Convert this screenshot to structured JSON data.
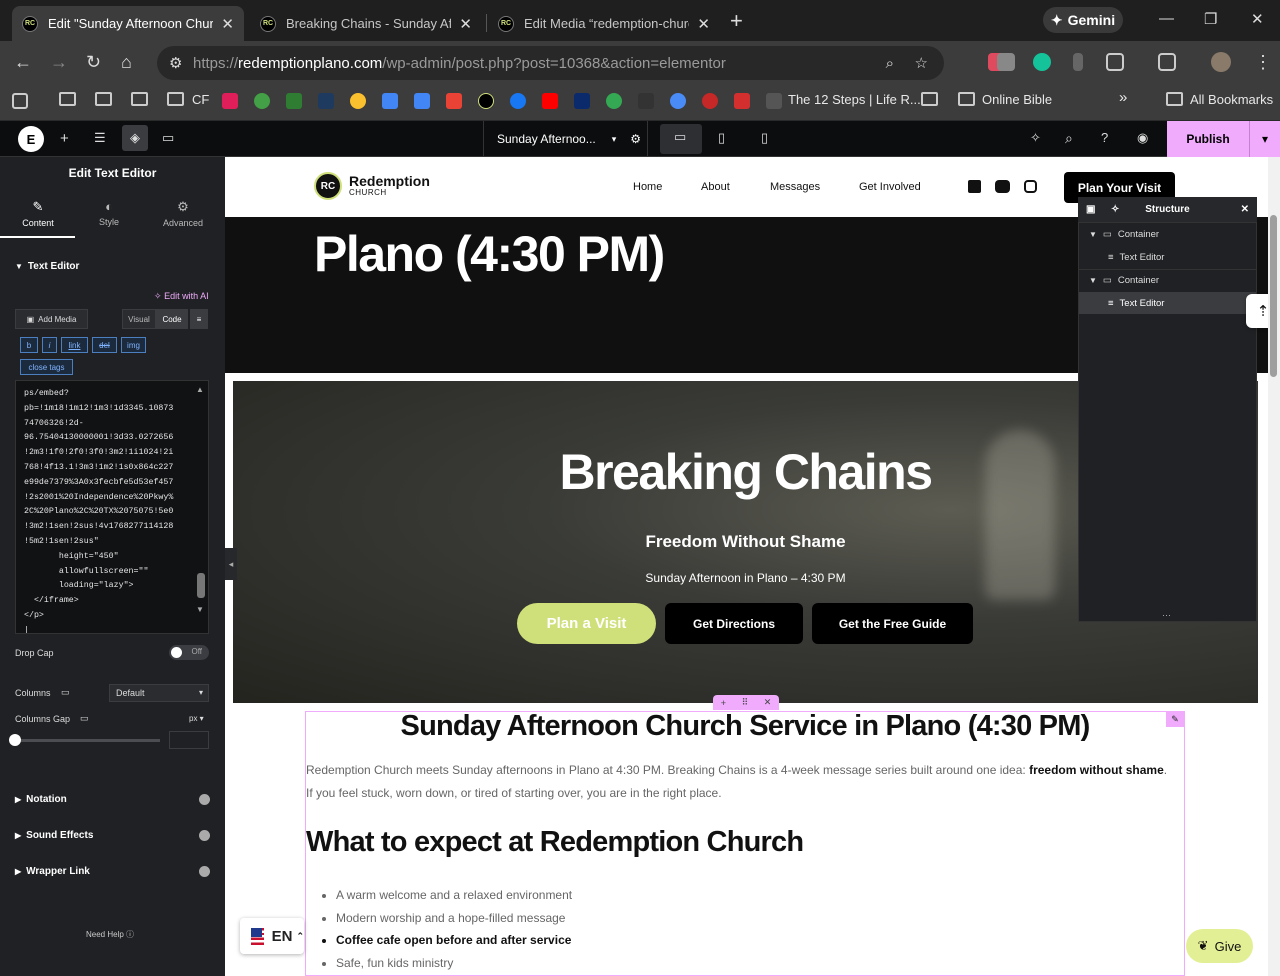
{
  "browser": {
    "tabs": [
      {
        "title": "Edit \"Sunday Afternoon Church",
        "active": true
      },
      {
        "title": "Breaking Chains - Sunday After",
        "active": false
      },
      {
        "title": "Edit Media “redemption-church",
        "active": false
      }
    ],
    "gemini_label": "Gemini",
    "url_prefix": "https://",
    "url_domain": "redemptionplano.com",
    "url_path": "/wp-admin/post.php?post=10368&action=elementor",
    "bookmarks": {
      "cf": "CF",
      "steps": "The 12 Steps | Life R...",
      "online_bible": "Online Bible",
      "all": "All Bookmarks"
    }
  },
  "editor": {
    "doc_title": "Sunday Afternoo...",
    "publish_label": "Publish",
    "panel_title": "Edit Text Editor",
    "panel_tabs": [
      "Content",
      "Style",
      "Advanced"
    ],
    "section_text_editor": "Text Editor",
    "edit_ai": "Edit with AI",
    "add_media": "Add Media",
    "visual_tab": "Visual",
    "code_tab": "Code",
    "quicktags": [
      "b",
      "i",
      "link",
      "del",
      "img",
      "close tags"
    ],
    "code": "ps/embed?\npb=!1m18!1m12!1m3!1d3345.10873\n74706326!2d-\n96.75404130000001!3d33.0272656\n!2m3!1f0!2f0!3f0!3m2!1i1024!2i\n768!4f13.1!3m3!1m2!1s0x864c227\ne99de7379%3A0x3fecbfe5d53ef457\n!2s2001%20Independence%20Pkwy%\n2C%20Plano%2C%20TX%2075075!5e0\n!3m2!1sen!2sus!4v1768277114128\n!5m2!1sen!2sus\"\n       height=\"450\"\n       allowfullscreen=\"\"\n       loading=\"lazy\">\n  </iframe>\n</p>\n|",
    "drop_cap_label": "Drop Cap",
    "drop_cap_state": "Off",
    "columns_label": "Columns",
    "columns_value": "Default",
    "columns_gap_label": "Columns Gap",
    "columns_gap_unit": "px",
    "sections": [
      "Notation",
      "Sound Effects",
      "Wrapper Link"
    ],
    "need_help": "Need Help",
    "structure_title": "Structure",
    "structure_rows": [
      "Container",
      "Text Editor",
      "Container",
      "Text Editor"
    ],
    "lang": "EN"
  },
  "site": {
    "logo_initials": "RC",
    "logo_name": "Redemption",
    "logo_sub": "CHURCH",
    "nav": [
      "Home",
      "About",
      "Messages",
      "Get Involved"
    ],
    "cta": "Plan Your Visit",
    "hero_top_title": "Plano (4:30 PM)",
    "hero_title": "Breaking Chains",
    "hero_subtitle": "Freedom Without Shame",
    "hero_time": "Sunday Afternoon in Plano – 4:30 PM",
    "hero_buttons": [
      "Plan a Visit",
      "Get Directions",
      "Get the Free Guide"
    ],
    "heading": "Sunday Afternoon Church Service in Plano (4:30 PM)",
    "intro_1": "Redemption Church meets Sunday afternoons in Plano at 4:30 PM. Breaking Chains is a 4-week message series built around one idea: ",
    "intro_bold": "freedom without shame",
    "intro_2": ". If you feel stuck, worn down, or tired of starting over, you are in the right place.",
    "expect_heading": "What to expect at Redemption Church",
    "expect_list": [
      "A warm welcome and a relaxed environment",
      "Modern worship and a hope-filled message",
      "Coffee cafe open before and after service",
      "Safe, fun kids ministry"
    ],
    "give_label": "Give"
  },
  "colors": {
    "accent_pink": "#f0abfc",
    "lime": "#cfe07a",
    "panel": "#1f2124"
  }
}
